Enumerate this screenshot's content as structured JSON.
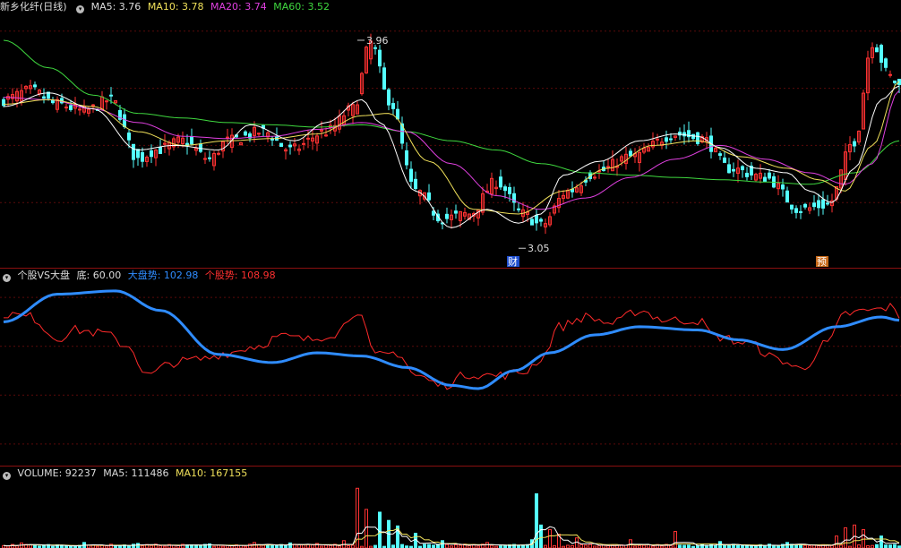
{
  "main_header": {
    "stock_name": "新乡化纤",
    "period": "(日线)",
    "ma5": "MA5: 3.76",
    "ma10": "MA10: 3.78",
    "ma20": "MA20: 3.74",
    "ma60": "MA60: 3.52"
  },
  "annotations": {
    "high_label": "3.96",
    "low_label": "3.05",
    "badge_cai": "财",
    "badge_yu": "预"
  },
  "indicator_header": {
    "name": "个股VS大盘",
    "bottom": "底: 60.00",
    "market": "大盘势: 102.98",
    "stock": "个股势: 108.98"
  },
  "volume_header": {
    "volume": "VOLUME: 92237",
    "ma5": "MA5: 111486",
    "ma10": "MA10: 167155"
  },
  "colors": {
    "up": "#ff3232",
    "down": "#54ffff",
    "ma5": "#ffffff",
    "ma10": "#f0e05a",
    "ma20": "#e040e0",
    "ma60": "#3fd83f",
    "market_line": "#2f8cff",
    "stock_line": "#ff2a2a",
    "separator": "#8a1010"
  },
  "chart_data": [
    {
      "type": "candlestick",
      "title": "新乡化纤 (日线)",
      "ylim": [
        3.0,
        4.05
      ],
      "series": [
        {
          "name": "MA5",
          "last": 3.76
        },
        {
          "name": "MA10",
          "last": 3.78
        },
        {
          "name": "MA20",
          "last": 3.74
        },
        {
          "name": "MA60",
          "last": 3.52
        }
      ],
      "ma_anchors": {
        "ma5": [
          [
            0,
            3.67
          ],
          [
            10,
            3.73
          ],
          [
            20,
            3.66
          ],
          [
            30,
            3.48
          ],
          [
            38,
            3.5
          ],
          [
            48,
            3.48
          ],
          [
            55,
            3.59
          ],
          [
            65,
            3.52
          ],
          [
            72,
            3.6
          ],
          [
            80,
            3.7
          ],
          [
            84,
            3.6
          ],
          [
            92,
            3.3
          ],
          [
            100,
            3.14
          ],
          [
            108,
            3.22
          ],
          [
            115,
            3.16
          ],
          [
            120,
            3.2
          ],
          [
            125,
            3.37
          ],
          [
            133,
            3.43
          ],
          [
            142,
            3.52
          ],
          [
            150,
            3.55
          ],
          [
            155,
            3.54
          ],
          [
            160,
            3.49
          ],
          [
            168,
            3.4
          ],
          [
            175,
            3.38
          ],
          [
            180,
            3.3
          ],
          [
            185,
            3.25
          ],
          [
            190,
            3.4
          ],
          [
            196,
            3.7
          ],
          [
            200,
            3.76
          ]
        ],
        "ma10": [
          [
            0,
            3.68
          ],
          [
            10,
            3.7
          ],
          [
            20,
            3.67
          ],
          [
            30,
            3.56
          ],
          [
            40,
            3.5
          ],
          [
            50,
            3.52
          ],
          [
            60,
            3.53
          ],
          [
            70,
            3.55
          ],
          [
            80,
            3.63
          ],
          [
            86,
            3.64
          ],
          [
            95,
            3.43
          ],
          [
            105,
            3.22
          ],
          [
            115,
            3.2
          ],
          [
            125,
            3.3
          ],
          [
            135,
            3.4
          ],
          [
            145,
            3.5
          ],
          [
            155,
            3.52
          ],
          [
            165,
            3.45
          ],
          [
            175,
            3.4
          ],
          [
            182,
            3.35
          ],
          [
            188,
            3.3
          ],
          [
            194,
            3.5
          ],
          [
            200,
            3.78
          ]
        ],
        "ma20": [
          [
            0,
            3.71
          ],
          [
            10,
            3.7
          ],
          [
            20,
            3.66
          ],
          [
            30,
            3.6
          ],
          [
            40,
            3.54
          ],
          [
            50,
            3.53
          ],
          [
            60,
            3.54
          ],
          [
            70,
            3.57
          ],
          [
            80,
            3.6
          ],
          [
            90,
            3.56
          ],
          [
            100,
            3.42
          ],
          [
            110,
            3.28
          ],
          [
            120,
            3.22
          ],
          [
            130,
            3.27
          ],
          [
            140,
            3.36
          ],
          [
            150,
            3.44
          ],
          [
            160,
            3.5
          ],
          [
            170,
            3.44
          ],
          [
            180,
            3.38
          ],
          [
            188,
            3.33
          ],
          [
            194,
            3.42
          ],
          [
            200,
            3.74
          ]
        ],
        "ma60": [
          [
            0,
            3.96
          ],
          [
            10,
            3.84
          ],
          [
            20,
            3.72
          ],
          [
            30,
            3.64
          ],
          [
            40,
            3.62
          ],
          [
            50,
            3.6
          ],
          [
            60,
            3.59
          ],
          [
            70,
            3.58
          ],
          [
            80,
            3.59
          ],
          [
            90,
            3.56
          ],
          [
            100,
            3.52
          ],
          [
            110,
            3.48
          ],
          [
            120,
            3.42
          ],
          [
            130,
            3.38
          ],
          [
            140,
            3.37
          ],
          [
            150,
            3.36
          ],
          [
            160,
            3.35
          ],
          [
            170,
            3.34
          ],
          [
            180,
            3.33
          ],
          [
            190,
            3.38
          ],
          [
            200,
            3.52
          ]
        ]
      },
      "price_anchors": [
        [
          0,
          3.7
        ],
        [
          6,
          3.74
        ],
        [
          12,
          3.68
        ],
        [
          18,
          3.65
        ],
        [
          24,
          3.7
        ],
        [
          30,
          3.44
        ],
        [
          34,
          3.48
        ],
        [
          40,
          3.52
        ],
        [
          46,
          3.44
        ],
        [
          50,
          3.52
        ],
        [
          58,
          3.56
        ],
        [
          64,
          3.48
        ],
        [
          72,
          3.56
        ],
        [
          78,
          3.66
        ],
        [
          82,
          3.95
        ],
        [
          86,
          3.7
        ],
        [
          92,
          3.3
        ],
        [
          98,
          3.18
        ],
        [
          104,
          3.2
        ],
        [
          110,
          3.34
        ],
        [
          116,
          3.2
        ],
        [
          120,
          3.15
        ],
        [
          126,
          3.3
        ],
        [
          132,
          3.38
        ],
        [
          140,
          3.45
        ],
        [
          150,
          3.55
        ],
        [
          156,
          3.53
        ],
        [
          162,
          3.4
        ],
        [
          170,
          3.36
        ],
        [
          178,
          3.22
        ],
        [
          184,
          3.24
        ],
        [
          190,
          3.52
        ],
        [
          194,
          3.95
        ],
        [
          198,
          3.8
        ],
        [
          200,
          3.76
        ]
      ],
      "high": 3.96,
      "low": 3.05
    },
    {
      "type": "line",
      "title": "个股VS大盘",
      "ylim": [
        20,
        130
      ],
      "bottom_level": 60.0,
      "series": [
        {
          "name": "大盘势",
          "last": 102.98,
          "anchors": [
            [
              0,
              105
            ],
            [
              12,
              122
            ],
            [
              25,
              124
            ],
            [
              35,
              112
            ],
            [
              48,
              85
            ],
            [
              60,
              80
            ],
            [
              70,
              86
            ],
            [
              80,
              84
            ],
            [
              90,
              77
            ],
            [
              100,
              66
            ],
            [
              106,
              64
            ],
            [
              114,
              75
            ],
            [
              122,
              86
            ],
            [
              132,
              97
            ],
            [
              142,
              102
            ],
            [
              155,
              100
            ],
            [
              164,
              94
            ],
            [
              174,
              88
            ],
            [
              186,
              102
            ],
            [
              196,
              108
            ],
            [
              200,
              106
            ]
          ]
        },
        {
          "name": "个股势",
          "last": 108.98,
          "anchors": [
            [
              0,
              110
            ],
            [
              6,
              108
            ],
            [
              12,
              95
            ],
            [
              16,
              100
            ],
            [
              22,
              98
            ],
            [
              28,
              90
            ],
            [
              32,
              72
            ],
            [
              38,
              80
            ],
            [
              44,
              82
            ],
            [
              50,
              86
            ],
            [
              56,
              90
            ],
            [
              62,
              96
            ],
            [
              68,
              94
            ],
            [
              74,
              98
            ],
            [
              79,
              112
            ],
            [
              83,
              84
            ],
            [
              88,
              86
            ],
            [
              92,
              72
            ],
            [
              98,
              66
            ],
            [
              104,
              73
            ],
            [
              110,
              72
            ],
            [
              116,
              74
            ],
            [
              120,
              82
            ],
            [
              124,
              102
            ],
            [
              130,
              108
            ],
            [
              136,
              104
            ],
            [
              142,
              112
            ],
            [
              148,
              106
            ],
            [
              155,
              106
            ],
            [
              159,
              96
            ],
            [
              166,
              92
            ],
            [
              173,
              82
            ],
            [
              178,
              76
            ],
            [
              184,
              92
            ],
            [
              188,
              110
            ],
            [
              194,
              112
            ],
            [
              198,
              114
            ],
            [
              200,
              109
            ]
          ]
        }
      ]
    },
    {
      "type": "bar",
      "title": "VOLUME",
      "ylim": [
        0,
        760000
      ],
      "series": [
        {
          "name": "VOLUME",
          "last": 92237
        },
        {
          "name": "MA5",
          "last": 111486
        },
        {
          "name": "MA10",
          "last": 167155
        }
      ],
      "spikes": [
        [
          4,
          55000
        ],
        [
          18,
          60000
        ],
        [
          30,
          50000
        ],
        [
          46,
          45000
        ],
        [
          56,
          60000
        ],
        [
          64,
          55000
        ],
        [
          70,
          50000
        ],
        [
          76,
          80000
        ],
        [
          79,
          650000
        ],
        [
          81,
          420000
        ],
        [
          84,
          390000
        ],
        [
          86,
          300000
        ],
        [
          88,
          240000
        ],
        [
          92,
          160000
        ],
        [
          98,
          80000
        ],
        [
          108,
          60000
        ],
        [
          118,
          90000
        ],
        [
          119,
          590000
        ],
        [
          120,
          250000
        ],
        [
          122,
          200000
        ],
        [
          124,
          150000
        ],
        [
          128,
          110000
        ],
        [
          140,
          90000
        ],
        [
          150,
          180000
        ],
        [
          160,
          70000
        ],
        [
          175,
          60000
        ],
        [
          186,
          130000
        ],
        [
          188,
          220000
        ],
        [
          190,
          250000
        ],
        [
          192,
          200000
        ],
        [
          196,
          130000
        ]
      ],
      "baseline": 28000
    }
  ]
}
